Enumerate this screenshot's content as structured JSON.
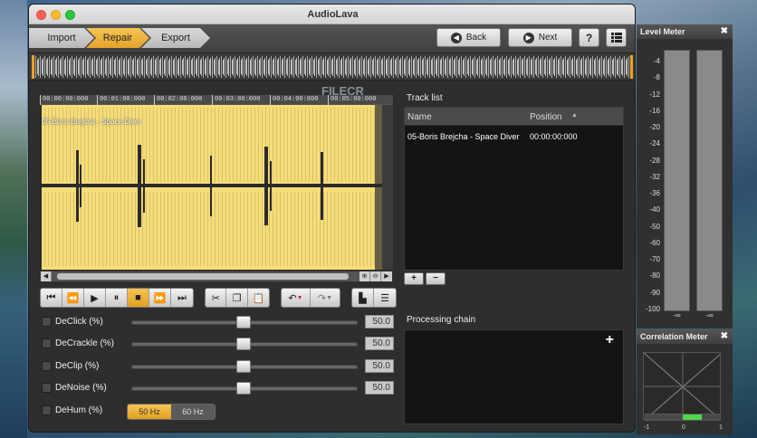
{
  "window": {
    "title": "AudioLava"
  },
  "steps": [
    "Import",
    "Repair",
    "Export"
  ],
  "toolbar": {
    "back_label": "Back",
    "next_label": "Next",
    "help_label": "?"
  },
  "ruler": [
    "00:00:00:000",
    "00:01:00:000",
    "00:02:00:000",
    "00:03:00:000",
    "00:04:00:000",
    "00:05:00:000"
  ],
  "track": {
    "name": "05-Boris Brejcha - Space Diver"
  },
  "watermark": "FILECR",
  "tracklist": {
    "title": "Track list",
    "col_name": "Name",
    "col_position": "Position",
    "rows": [
      {
        "name": "05-Boris Brejcha - Space Diver",
        "position": "00:00:00:000"
      }
    ],
    "add_label": "+",
    "remove_label": "−"
  },
  "processing": {
    "title": "Processing chain",
    "add_label": "+"
  },
  "params": [
    {
      "label": "DeClick (%)",
      "value": "50.0",
      "level": 50
    },
    {
      "label": "DeCrackle (%)",
      "value": "50.0",
      "level": 50
    },
    {
      "label": "DeClip (%)",
      "value": "50.0",
      "level": 50
    },
    {
      "label": "DeNoise (%)",
      "value": "50.0",
      "level": 50
    }
  ],
  "dehum": {
    "label": "DeHum (%)",
    "option_50": "50 Hz",
    "option_60": "60 Hz",
    "selected": "50 Hz"
  },
  "level_meter": {
    "title": "Level Meter",
    "close_label": "✖",
    "ticks": [
      "-4",
      "-8",
      "-12",
      "-16",
      "-20",
      "-24",
      "-28",
      "-32",
      "-36",
      "-40",
      "-50",
      "-60",
      "-70",
      "-80",
      "-90",
      "-100"
    ],
    "left_value": "-∞",
    "right_value": "-∞"
  },
  "correlation_meter": {
    "title": "Correlation Meter",
    "close_label": "✖",
    "labels": [
      "-1",
      "0",
      "1"
    ],
    "value": 0.5
  },
  "colors": {
    "accent": "#f0b33a",
    "waveform_bg": "#f7dd78",
    "waveform": "#2b2b2b",
    "meter_green": "#52d64a"
  },
  "icons": [
    "back-icon",
    "next-icon",
    "help-icon",
    "list-icon",
    "skip-start-icon",
    "rewind-icon",
    "play-icon",
    "pause-icon",
    "stop-icon",
    "fast-forward-icon",
    "skip-end-icon",
    "cut-icon",
    "copy-icon",
    "paste-icon",
    "undo-icon",
    "redo-icon",
    "spectrum-icon",
    "markers-icon",
    "zoom-in-icon",
    "zoom-out-icon"
  ]
}
